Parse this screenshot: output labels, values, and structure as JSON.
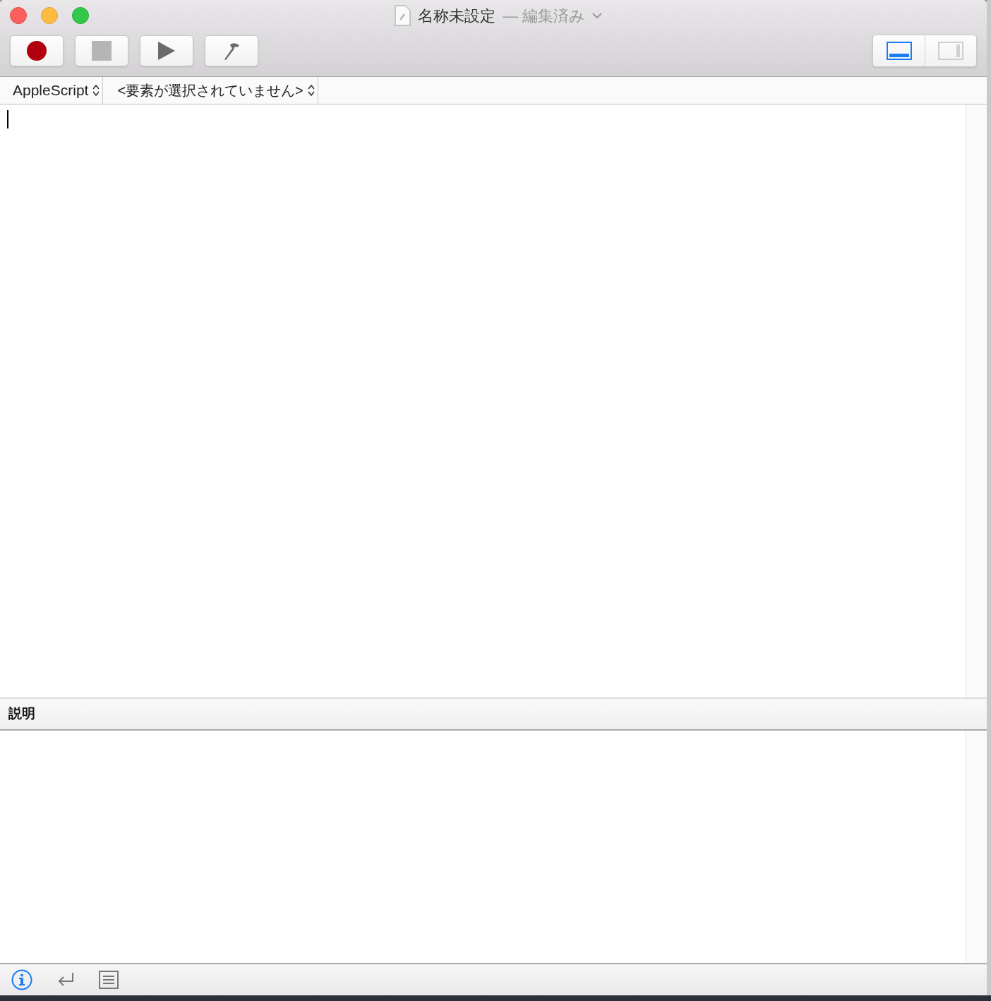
{
  "window": {
    "title": "名称未設定",
    "edited": "— 編集済み"
  },
  "toolbar": {
    "buttons": [
      {
        "kind": "record"
      },
      {
        "kind": "stop"
      },
      {
        "kind": "run"
      },
      {
        "kind": "compile"
      }
    ],
    "view_buttons": [
      {
        "kind": "bottom",
        "selected": true
      },
      {
        "kind": "side",
        "selected": false
      }
    ]
  },
  "navigation": {
    "language": "AppleScript",
    "element": "<要素が選択されていません>"
  },
  "description_pane": {
    "title": "説明"
  },
  "bottom_bar": [
    {
      "kind": "info",
      "selected": true
    },
    {
      "kind": "return",
      "selected": false
    },
    {
      "kind": "list",
      "selected": false
    }
  ]
}
